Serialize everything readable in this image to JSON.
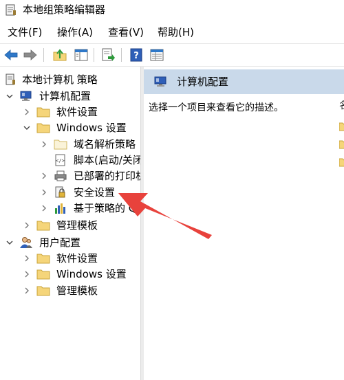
{
  "window": {
    "title": "本地组策略编辑器"
  },
  "menu": {
    "file": "文件(F)",
    "action": "操作(A)",
    "view": "查看(V)",
    "help": "帮助(H)"
  },
  "tree": {
    "root": "本地计算机 策略",
    "computer_config": "计算机配置",
    "software_settings": "软件设置",
    "windows_settings": "Windows 设置",
    "dns_policy": "域名解析策略",
    "scripts": "脚本(启动/关闭)",
    "deployed_printers": "已部署的打印机",
    "security_settings": "安全设置",
    "qos_policy": "基于策略的 QoS",
    "admin_templates": "管理模板",
    "user_config": "用户配置",
    "user_software_settings": "软件设置",
    "user_windows_settings": "Windows 设置",
    "user_admin_templates": "管理模板"
  },
  "right_panel": {
    "header": "计算机配置",
    "description": "选择一个项目来查看它的描述。",
    "column_fragment": "名"
  },
  "colors": {
    "header_bg": "#c9d9ea",
    "folder": "#f5d57a",
    "arrow": "#e8423c",
    "nav_blue": "#2f78c8"
  },
  "icons": {
    "toolbar": [
      "back-arrow-icon",
      "forward-arrow-icon",
      "up-folder-icon",
      "show-hide-tree-icon",
      "export-list-icon",
      "help-icon",
      "properties-view-icon"
    ]
  }
}
